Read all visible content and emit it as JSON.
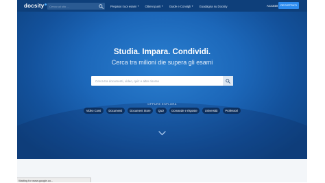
{
  "navbar": {
    "logo": "docsity",
    "search_placeholder": "Cerca sul sito ...",
    "links": [
      {
        "label": "Prepara i tuoi esami",
        "has_caret": true
      },
      {
        "label": "Ottieni punti",
        "has_caret": true
      },
      {
        "label": "Guide e Consigli",
        "has_caret": true
      },
      {
        "label": "Guadagna su Docsity",
        "has_caret": false
      }
    ],
    "login": "ACCEDI",
    "register": "REGISTRATI"
  },
  "hero": {
    "headline": "Studia. Impara. Condividi.",
    "subheadline": "Cerca tra milioni die supera gli esami",
    "search_placeholder": "Cerca tra documenti, video, quiz e altre risorse",
    "or_explore": "OPPURE ESPLORA",
    "chips": [
      "Video Corsi",
      "Documenti",
      "Document Store",
      "Quiz",
      "Domande e risposte",
      "Università",
      "Professori"
    ]
  },
  "status_bar": {
    "text": "Waiting for www.google.co..."
  },
  "colors": {
    "navbar_bg": "#0e3f7a",
    "hero_blue": "#1c67b9",
    "register_blue": "#2d8cf0",
    "chip_bg": "#0c2f5e"
  },
  "icons": {
    "search": "search-icon",
    "scroll_down": "chevron-down-icon"
  }
}
